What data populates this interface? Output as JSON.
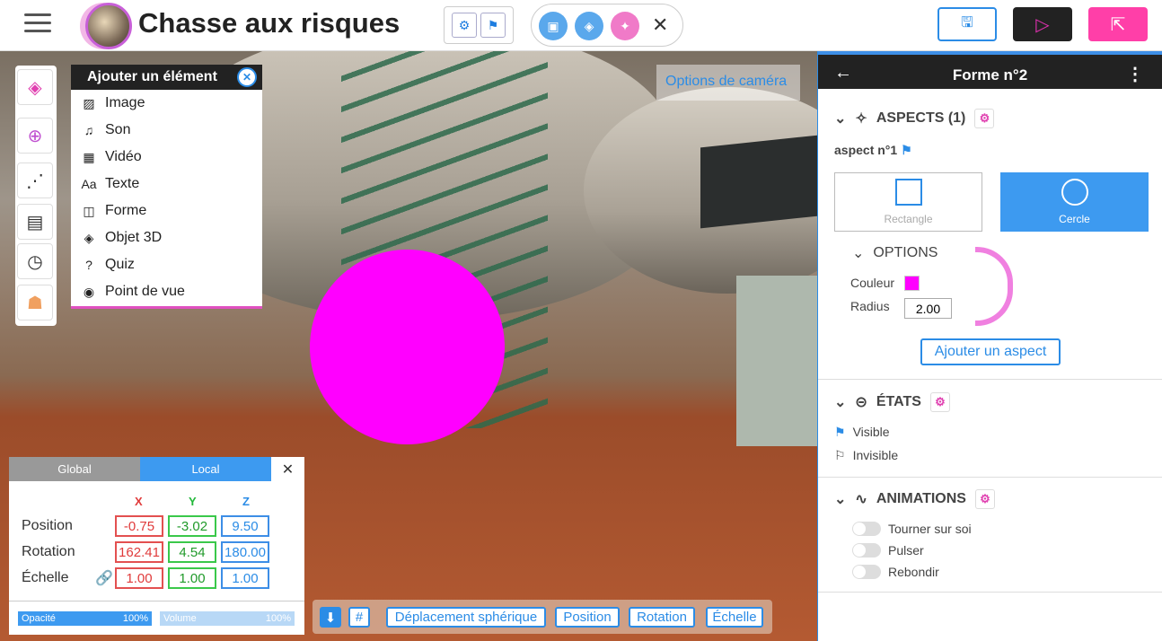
{
  "header": {
    "title": "Chasse aux risques",
    "colors": {
      "accent": "#2b8ce6",
      "pink": "#ff3fa8"
    }
  },
  "scene": {
    "camera_options": "Options de caméra"
  },
  "add_menu": {
    "title": "Ajouter un élément",
    "items": [
      {
        "label": "Image",
        "icon": "image-icon"
      },
      {
        "label": "Son",
        "icon": "headphones-icon"
      },
      {
        "label": "Vidéo",
        "icon": "film-icon"
      },
      {
        "label": "Texte",
        "icon": "text-icon"
      },
      {
        "label": "Forme",
        "icon": "shape-icon"
      },
      {
        "label": "Objet 3D",
        "icon": "cube-icon"
      },
      {
        "label": "Quiz",
        "icon": "question-icon"
      },
      {
        "label": "Point de vue",
        "icon": "viewpoint-icon"
      }
    ]
  },
  "transform": {
    "tabs": {
      "global": "Global",
      "local": "Local"
    },
    "axes": {
      "x": "X",
      "y": "Y",
      "z": "Z"
    },
    "rows": {
      "position": "Position",
      "rotation": "Rotation",
      "scale": "Échelle"
    },
    "position": {
      "x": "-0.75",
      "y": "-3.02",
      "z": "9.50"
    },
    "rotation": {
      "x": "162.41",
      "y": "4.54",
      "z": "180.00"
    },
    "scale": {
      "x": "1.00",
      "y": "1.00",
      "z": "1.00"
    },
    "opacity": {
      "label": "Opacité",
      "value": "100%"
    },
    "volume": {
      "label": "Volume",
      "value": "100%"
    }
  },
  "bottom": {
    "spherical": "Déplacement sphérique",
    "position": "Position",
    "rotation": "Rotation",
    "scale": "Échelle"
  },
  "panel": {
    "title": "Forme n°2",
    "aspects": "ASPECTS (1)",
    "aspect_name": "aspect n°1",
    "shapes": {
      "rectangle": "Rectangle",
      "circle": "Cercle"
    },
    "options": "OPTIONS",
    "color_label": "Couleur",
    "color_value": "#ff00ff",
    "radius_label": "Radius",
    "radius_value": "2.00",
    "add_aspect": "Ajouter un aspect",
    "states": "ÉTATS",
    "visible": "Visible",
    "invisible": "Invisible",
    "animations": "ANIMATIONS",
    "anim": {
      "spin": "Tourner sur soi",
      "pulse": "Pulser",
      "bounce": "Rebondir"
    }
  }
}
